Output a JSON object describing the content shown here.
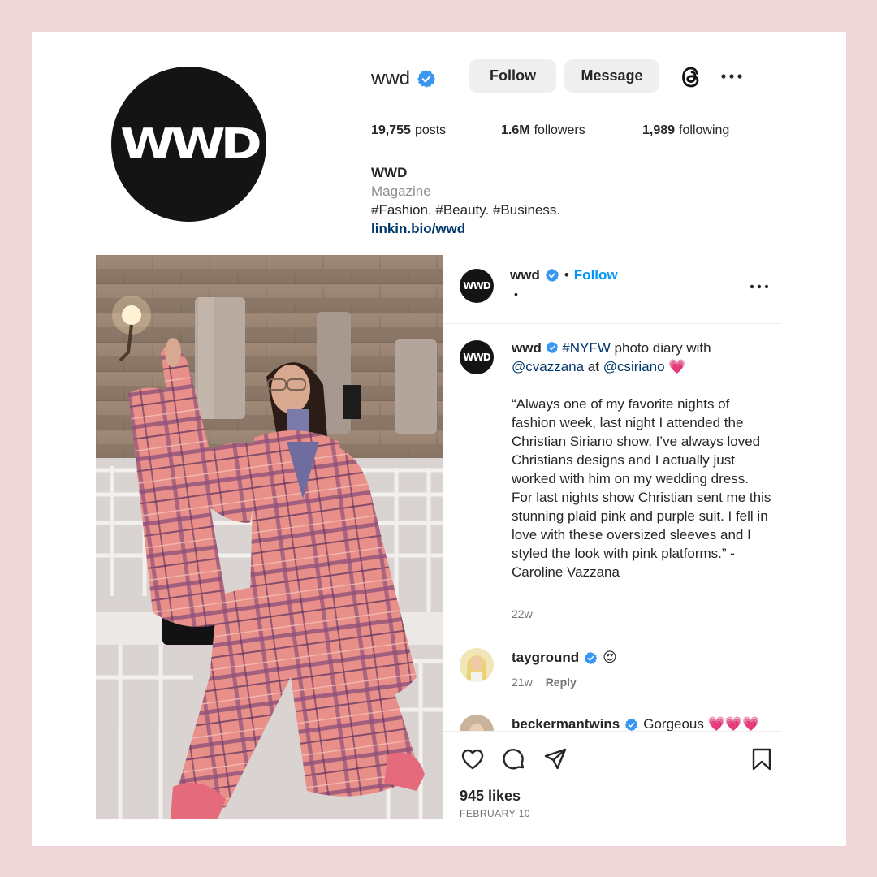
{
  "profile": {
    "username": "wwd",
    "avatar_text": "WWD",
    "follow_label": "Follow",
    "message_label": "Message",
    "stats": {
      "posts_count": "19,755",
      "posts_label": "posts",
      "followers_count": "1.6M",
      "followers_label": "followers",
      "following_count": "1,989",
      "following_label": "following"
    },
    "bio": {
      "name": "WWD",
      "category": "Magazine",
      "text": "#Fashion. #Beauty. #Business.",
      "link": "linkin.bio/wwd"
    }
  },
  "post": {
    "header": {
      "avatar_text": "WWD",
      "username": "wwd",
      "separator": "•",
      "follow_label": "Follow",
      "subline": "•"
    },
    "caption": {
      "avatar_text": "WWD",
      "username": "wwd",
      "hashtag": "#NYFW",
      "text_1": " photo diary with ",
      "mention_1": "@cvazzana",
      "text_2": " at ",
      "mention_2": "@csiriano",
      "emoji": "💗",
      "body": "“Always one of my favorite nights of fashion week, last night I attended the Christian Siriano show. I’ve always loved Christians designs and I actually just worked with him on my wedding dress. For last nights show Christian sent me this stunning plaid pink and purple suit. I fell in love with these oversized sleeves and I styled the look with pink platforms.” - Caroline Vazzana",
      "time": "22w"
    },
    "comments": [
      {
        "username": "tayground",
        "text": "😍",
        "time": "21w",
        "reply_label": "Reply"
      },
      {
        "username": "beckermantwins",
        "text": "Gorgeous 💗💗💗"
      }
    ],
    "likes": "945 likes",
    "date": "FEBRUARY 10"
  },
  "icons": {
    "verified": "verified-badge-icon",
    "threads": "threads-icon",
    "more": "more-options-icon",
    "like": "heart-icon",
    "comment": "comment-icon",
    "share": "share-icon",
    "save": "bookmark-icon"
  },
  "colors": {
    "background": "#efd6d8",
    "link_blue": "#0095f6",
    "verified_blue": "#3897f0",
    "tag_blue": "#00376b",
    "button_gray": "#efefef"
  }
}
